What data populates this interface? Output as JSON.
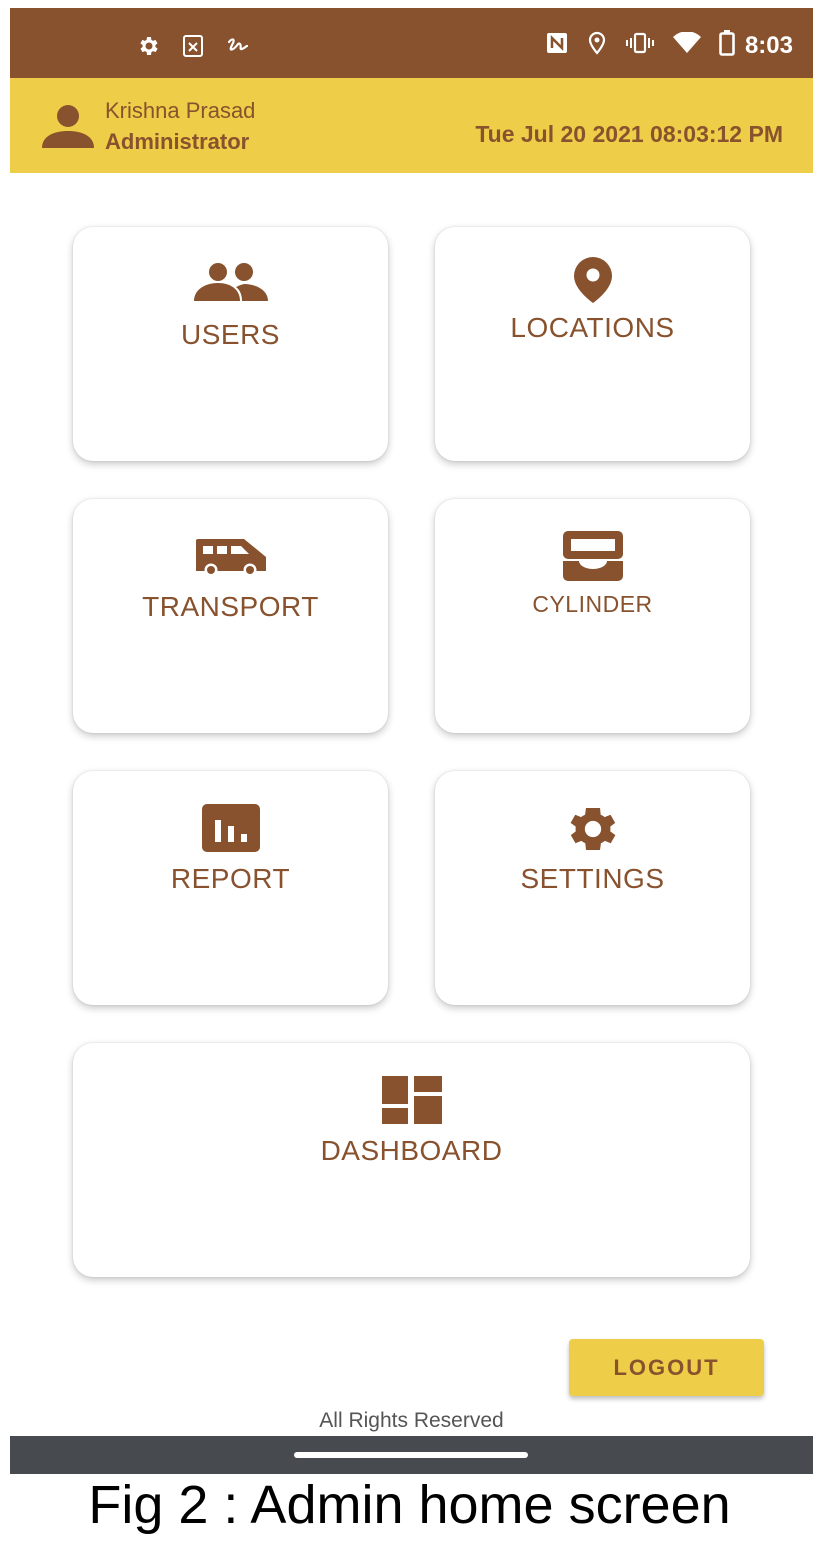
{
  "status_bar": {
    "time": "8:03",
    "left_icons": [
      "gear-icon",
      "sim-error-icon",
      "signature-icon"
    ],
    "right_icons": [
      "nfc-icon",
      "location-icon",
      "vibrate-icon",
      "wifi-icon",
      "battery-icon"
    ]
  },
  "header": {
    "user_name": "Krishna Prasad",
    "user_role": "Administrator",
    "datetime": "Tue Jul 20 2021 08:03:12 PM"
  },
  "tiles": {
    "users": {
      "label": "USERS",
      "icon": "group-icon"
    },
    "locations": {
      "label": "LOCATIONS",
      "icon": "map-pin-icon"
    },
    "transport": {
      "label": "TRANSPORT",
      "icon": "van-icon"
    },
    "cylinder": {
      "label": "CYLINDER",
      "icon": "inbox-tray-icon"
    },
    "report": {
      "label": "REPORT",
      "icon": "bar-chart-icon"
    },
    "settings": {
      "label": "SETTINGS",
      "icon": "gear-icon"
    },
    "dashboard": {
      "label": "DASHBOARD",
      "icon": "dashboard-icon"
    }
  },
  "logout_label": "LOGOUT",
  "footer_text": "All Rights Reserved",
  "caption": "Fig 2 : Admin home screen",
  "colors": {
    "brown": "#87522d",
    "yellow": "#eecd48",
    "nav_bar": "#474b4f"
  }
}
